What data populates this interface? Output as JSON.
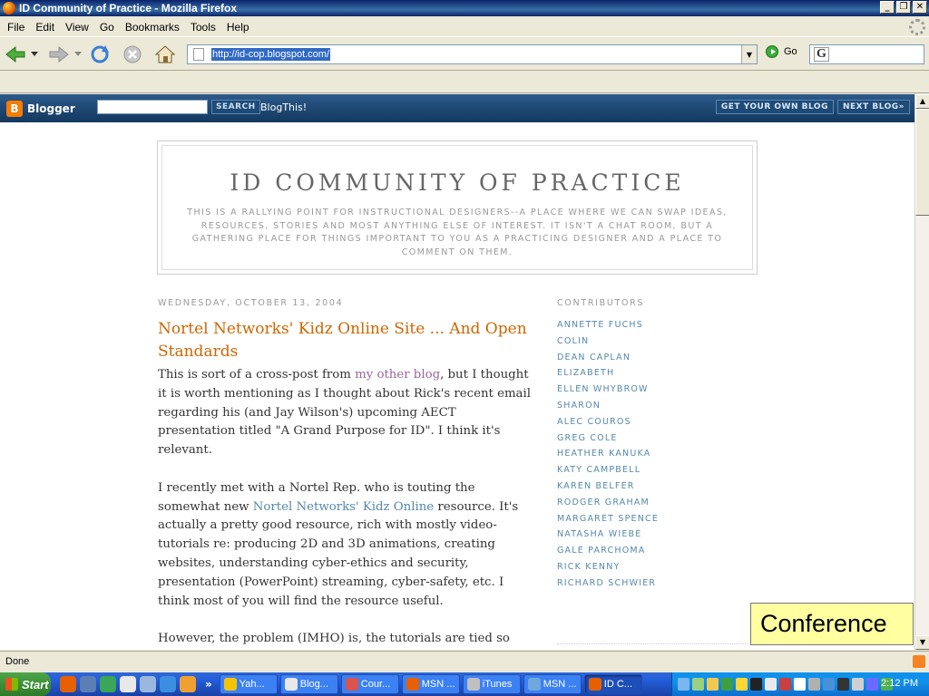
{
  "window": {
    "title": "ID Community of Practice - Mozilla Firefox",
    "controls": [
      "_",
      "❐",
      "✕"
    ]
  },
  "menu": [
    "File",
    "Edit",
    "View",
    "Go",
    "Bookmarks",
    "Tools",
    "Help"
  ],
  "toolbar": {
    "url": "http://id-cop.blogspot.com/",
    "go_label": "Go",
    "search_engine_glyph": "G"
  },
  "blogger_bar": {
    "logo_text": "Blogger",
    "search_button": "SEARCH",
    "blogthis": "BlogThis!",
    "get_blog": "GET YOUR OWN BLOG",
    "next_blog": "NEXT BLOG»"
  },
  "blog": {
    "title": "ID COMMUNITY OF PRACTICE",
    "description": "THIS IS A RALLYING POINT FOR INSTRUCTIONAL DESIGNERS--A PLACE WHERE WE CAN SWAP IDEAS, RESOURCES, STORIES AND MOST ANYTHING ELSE OF INTEREST. IT ISN'T A CHAT ROOM, BUT A GATHERING PLACE FOR THINGS IMPORTANT TO YOU AS A PRACTICING DESIGNER AND A PLACE TO COMMENT ON THEM."
  },
  "post": {
    "date": "WEDNESDAY, OCTOBER 13, 2004",
    "title": "Nortel Networks' Kidz Online Site ... And Open Standards",
    "p1_a": "This is sort of a cross-post from ",
    "p1_link": "my other blog",
    "p1_b": ", but I thought it is worth mentioning as I thought about Rick's recent email regarding his (and Jay Wilson's) upcoming AECT presentation titled \"A Grand Purpose for ID\". I think it's relevant.",
    "p2_a": "I recently met with a Nortel Rep. who is touting the somewhat new ",
    "p2_link": "Nortel Networks' Kidz Online",
    "p2_b": " resource. It's actually a pretty good resource, rich with mostly video-tutorials re: producing 2D and 3D animations, creating websites, understanding cyber-ethics and security, presentation (PowerPoint) streaming, cyber-safety, etc. I think most of you will find the resource useful.",
    "p3": "However, the problem (IMHO) is, the tutorials are tied so tightly to Microsoft IE and Windows Media Player that it almost makes it useless on any other platform (e.g, Mac, Linux). Of course, when"
  },
  "sidebar": {
    "heading": "CONTRIBUTORS",
    "contributors": [
      "ANNETTE FUCHS",
      "COLIN",
      "DEAN CAPLAN",
      "ELIZABETH",
      "ELLEN WHYBROW",
      "SHARON",
      "ALEC COUROS",
      "GREG COLE",
      "HEATHER KANUKA",
      "KATY CAMPBELL",
      "KAREN BELFER",
      "RODGER GRAHAM",
      "MARGARET SPENCE",
      "NATASHA WIEBE",
      "GALE PARCHOMA",
      "RICK KENNY",
      "RICHARD SCHWIER"
    ]
  },
  "sticky_note": "Conference",
  "status": "Done",
  "taskbar": {
    "start": "Start",
    "overflow": "»",
    "tasks": [
      {
        "label": "Yah...",
        "color": "#f5c400"
      },
      {
        "label": "Blog...",
        "color": "#e8e8e8"
      },
      {
        "label": "Cour...",
        "color": "#d9534f"
      },
      {
        "label": "MSN ...",
        "color": "#e66000"
      },
      {
        "label": "iTunes",
        "color": "#c0c0c0"
      },
      {
        "label": "MSN ...",
        "color": "#6fa8dc"
      },
      {
        "label": "ID C...",
        "color": "#e66000"
      }
    ],
    "clock": "2:12 PM"
  },
  "colors": {
    "post_title": "#cc6600",
    "link": "#5588aa",
    "visited_link": "#996699",
    "blogger_bar": "#13385f",
    "sticky": "#ffffa0"
  }
}
